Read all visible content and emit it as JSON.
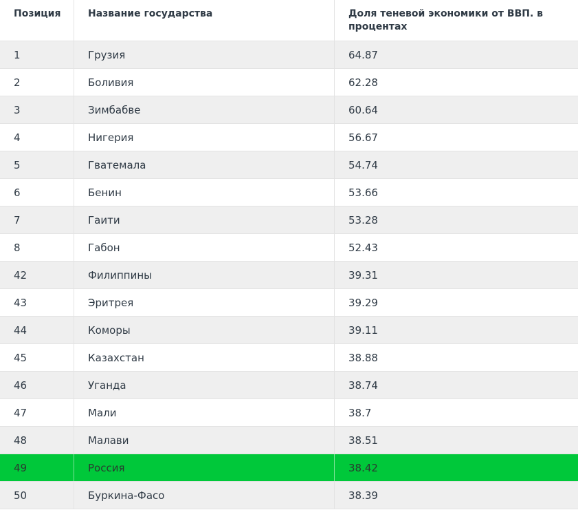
{
  "table": {
    "headers": {
      "position": "Позиция",
      "country": "Название государства",
      "share": "Доля теневой экономики от ВВП. в процентах"
    },
    "rows": [
      {
        "pos": "1",
        "country": "Грузия",
        "share": "64.87"
      },
      {
        "pos": "2",
        "country": "Боливия",
        "share": "62.28"
      },
      {
        "pos": "3",
        "country": "Зимбабве",
        "share": "60.64"
      },
      {
        "pos": "4",
        "country": "Нигерия",
        "share": "56.67"
      },
      {
        "pos": "5",
        "country": "Гватемала",
        "share": "54.74"
      },
      {
        "pos": "6",
        "country": "Бенин",
        "share": "53.66"
      },
      {
        "pos": "7",
        "country": "Гаити",
        "share": "53.28"
      },
      {
        "pos": "8",
        "country": "Габон",
        "share": "52.43"
      },
      {
        "pos": "42",
        "country": "Филиппины",
        "share": "39.31"
      },
      {
        "pos": "43",
        "country": "Эритрея",
        "share": "39.29"
      },
      {
        "pos": "44",
        "country": "Коморы",
        "share": "39.11"
      },
      {
        "pos": "45",
        "country": "Казахстан",
        "share": "38.88"
      },
      {
        "pos": "46",
        "country": "Уганда",
        "share": "38.74"
      },
      {
        "pos": "47",
        "country": "Мали",
        "share": "38.7"
      },
      {
        "pos": "48",
        "country": "Малави",
        "share": "38.51"
      },
      {
        "pos": "49",
        "country": "Россия",
        "share": "38.42"
      },
      {
        "pos": "50",
        "country": "Буркина-Фасо",
        "share": "38.39"
      }
    ],
    "highlight_color": "#00c83a",
    "alt_row_color": "#efefef"
  }
}
